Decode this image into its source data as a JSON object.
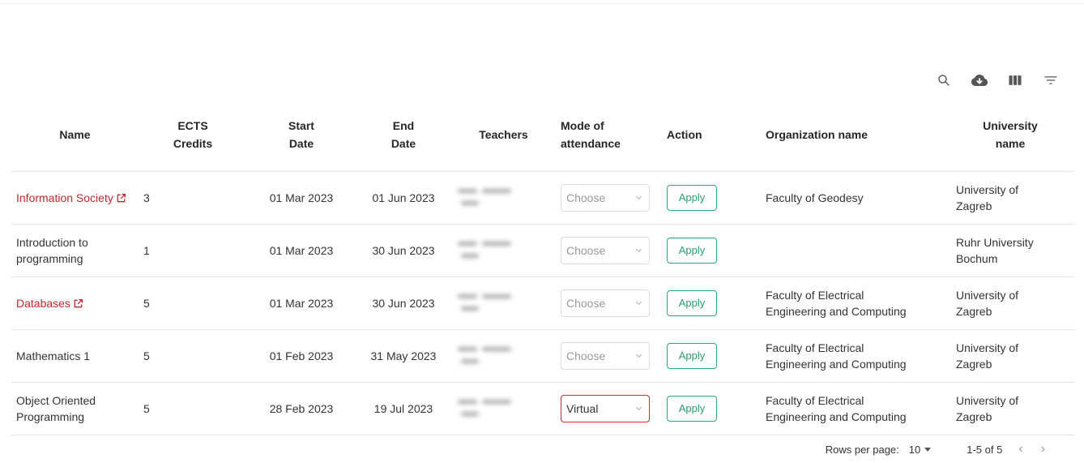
{
  "toolbar": {
    "icons": [
      "search-icon",
      "cloud-download-icon",
      "view-columns-icon",
      "filter-list-icon"
    ]
  },
  "table": {
    "headers": {
      "name": "Name",
      "ects": [
        "ECTS",
        "Credits"
      ],
      "start": [
        "Start",
        "Date"
      ],
      "end": [
        "End",
        "Date"
      ],
      "teachers": "Teachers",
      "mode": [
        "Mode of",
        "attendance"
      ],
      "action": "Action",
      "org": "Organization name",
      "univ": [
        "University",
        "name"
      ]
    },
    "rows": [
      {
        "name": "Information Society",
        "is_link": true,
        "ects": "3",
        "start": "01 Mar 2023",
        "end": "01 Jun 2023",
        "mode": "Choose",
        "action": "Apply",
        "org": "Faculty of Geodesy",
        "univ": "University of Zagreb"
      },
      {
        "name": "Introduction to programming",
        "is_link": false,
        "ects": "1",
        "start": "01 Mar 2023",
        "end": "30 Jun 2023",
        "mode": "Choose",
        "action": "Apply",
        "org": "",
        "univ": "Ruhr University Bochum"
      },
      {
        "name": "Databases",
        "is_link": true,
        "ects": "5",
        "start": "01 Mar 2023",
        "end": "30 Jun 2023",
        "mode": "Choose",
        "action": "Apply",
        "org": "Faculty of Electrical Engineering and Computing",
        "univ": "University of Zagreb"
      },
      {
        "name": "Mathematics 1",
        "is_link": false,
        "ects": "5",
        "start": "01 Feb 2023",
        "end": "31 May 2023",
        "mode": "Choose",
        "action": "Apply",
        "org": "Faculty of Electrical Engineering and Computing",
        "univ": "University of Zagreb"
      },
      {
        "name": "Object Oriented Programming",
        "is_link": false,
        "ects": "5",
        "start": "28 Feb 2023",
        "end": "19 Jul 2023",
        "mode": "Virtual",
        "mode_error": true,
        "action": "Apply",
        "org": "Faculty of Electrical Engineering and Computing",
        "univ": "University of Zagreb"
      }
    ]
  },
  "pagination": {
    "rows_label": "Rows per page:",
    "rows_value": "10",
    "range": "1-5 of 5",
    "prev": "‹",
    "next": "›"
  },
  "colors": {
    "link": "#c0272d",
    "apply": "#2a9b70",
    "error_border": "#d42a33"
  }
}
